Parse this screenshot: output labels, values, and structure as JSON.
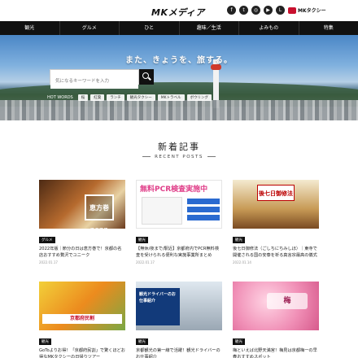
{
  "header": {
    "logo": "MKメディア",
    "social_icons": [
      "facebook-icon",
      "twitter-icon",
      "instagram-icon",
      "youtube-icon",
      "line-icon"
    ],
    "partner_logo": "MKタクシー"
  },
  "nav": {
    "items": [
      "観光",
      "グルメ",
      "ひと",
      "趣味／生活",
      "よみもの",
      "特集"
    ]
  },
  "hero": {
    "tagline": "また、きょうを、旅する。",
    "search_placeholder": "気になるキーワードを入力",
    "hot_words_title": "HOT WORDS",
    "hot_words": [
      "桜",
      "紅葉",
      "ランチ",
      "観光タクシー",
      "MKトラベル",
      "ボウリング"
    ]
  },
  "section": {
    "title": "新着記事",
    "subtitle": "RECENT POSTS"
  },
  "cards": [
    {
      "category": "グルメ",
      "title": "2022年版｜節分の日は恵方巻で！京都の名店おすすめ贅沢でユニーク",
      "date": "2022.01.17",
      "thumb_text": "恵方巻2022"
    },
    {
      "category": "観光",
      "title": "【無休/夜まで/駅近】京都府内でPCR無料検査を受けられる便利な実施事業所まとめ",
      "date": "2022.01.17",
      "thumb_text": "無料PCR検査実施中"
    },
    {
      "category": "観光",
      "title": "後七日御修法（ごしちにちみしほ）｜東寺で開催される国の安泰を祈る真言宗最高の儀式",
      "date": "2022.01.14",
      "thumb_text": "後七日御修法"
    },
    {
      "category": "観光",
      "title": "GoToよりお得！「京都府民割」で驚くほどお得なMKタクシーの日帰りツアー",
      "date": "",
      "thumb_text": "京都府民割"
    },
    {
      "category": "観光",
      "title": "京都観光の第一線で活躍！観光ドライバーのお仕事紹介",
      "date": "",
      "thumb_text": "観光ドライバーのお仕事紹介"
    },
    {
      "category": "観光",
      "title": "梅といえば北野天満宮！梅見は京都梅一の早春おすすめスポット",
      "date": "",
      "thumb_text": "梅"
    }
  ]
}
